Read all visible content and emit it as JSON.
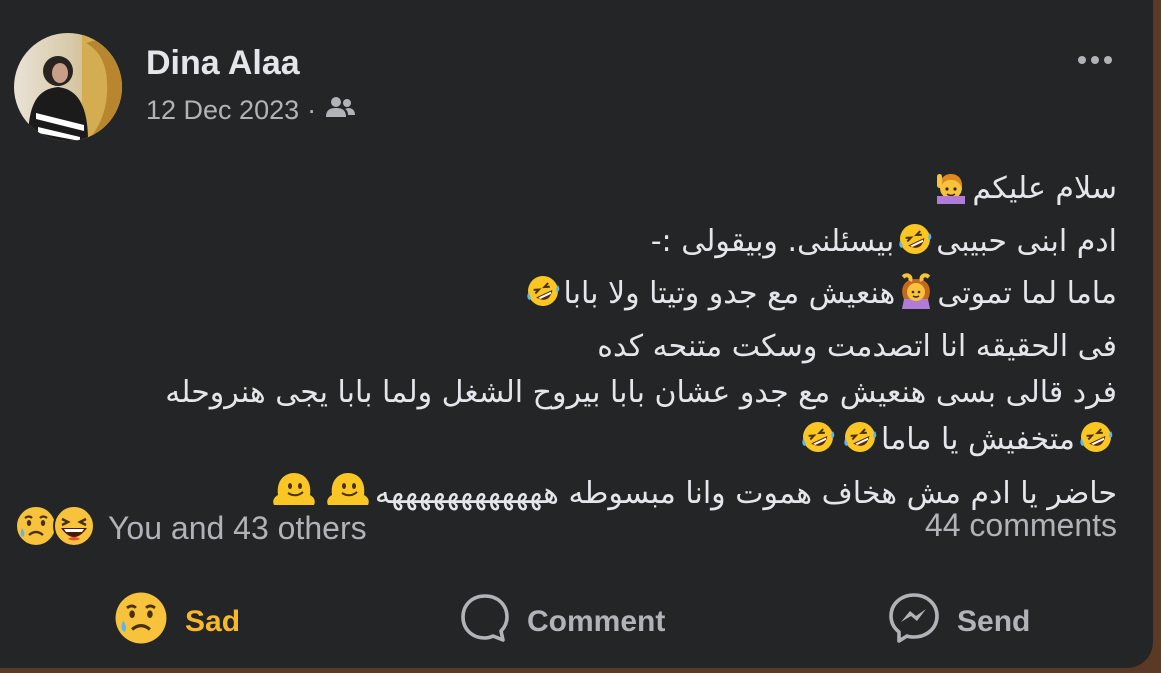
{
  "post": {
    "author": "Dina Alaa",
    "date": "12 Dec 2023",
    "separator": "·",
    "audience_icon": "friends-icon",
    "lines": [
      "سلام عليكم",
      "ادم ابنى حبيبى",
      "بيسئلنى. وبيقولى :-",
      "ماما لما تموتى",
      "هنعيش مع جدو وتيتا ولا بابا",
      "فى الحقيقه انا اتصدمت  وسكت متنحه كده",
      "فرد قالى بسى هنعيش مع جدو عشان بابا  بيروح الشغل ولما بابا يجى هنروحله",
      "متخفيش يا ماما",
      "حاضر يا ادم مش هخاف هموت وانا مبسوطه ههههههههههههه"
    ]
  },
  "reactions": {
    "icons": [
      "sad-reaction-icon",
      "haha-reaction-icon"
    ],
    "summary": "You and 43 others",
    "comments": "44 comments"
  },
  "actions": {
    "sad_label": "Sad",
    "comment_label": "Comment",
    "send_label": "Send"
  },
  "colors": {
    "card": "#242526",
    "text": "#e4e6eb",
    "secondary": "#b0b3b8",
    "sad_accent": "#f7b928"
  }
}
